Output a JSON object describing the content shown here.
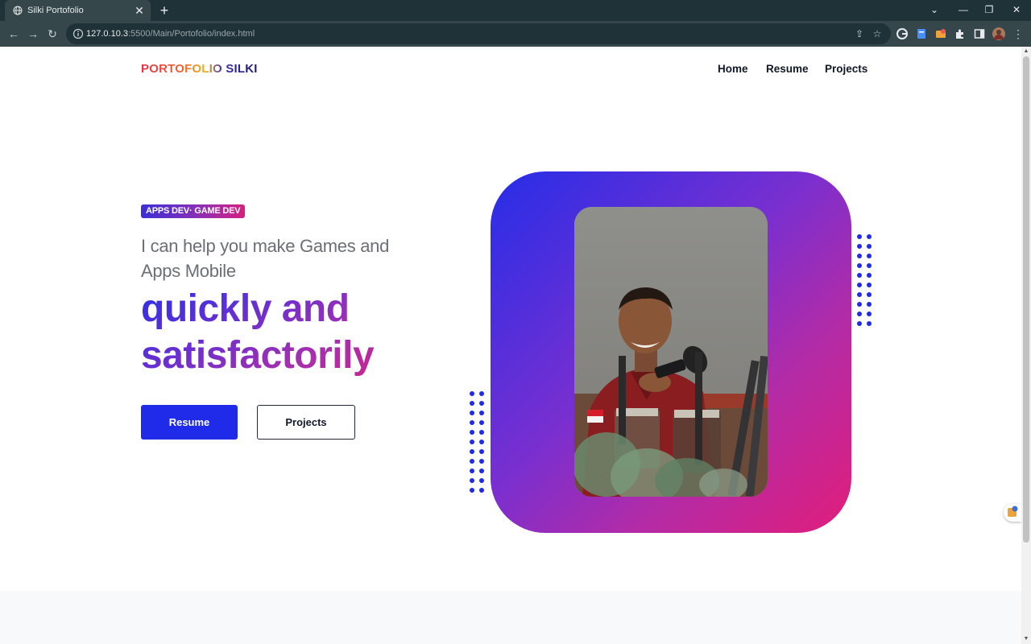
{
  "browser": {
    "tab_title": "Silki Portofolio",
    "url_host": "127.0.10.3",
    "url_rest": ":5500/Main/Portofolio/index.html",
    "icons": {
      "globe": "globe-icon",
      "close": "close-icon",
      "new_tab": "plus-icon",
      "back": "arrow-left-icon",
      "forward": "arrow-right-icon",
      "reload": "reload-icon",
      "info": "info-icon",
      "share": "share-icon",
      "bookmark": "star-icon",
      "extensions": "puzzle-icon",
      "sidepanel": "sidepanel-icon",
      "menu": "more-vertical-icon"
    },
    "colors": {
      "tabbar": "#1f3237",
      "toolbar": "#35474b"
    }
  },
  "site": {
    "logo": "PORTOFOLIO SILKI",
    "nav": [
      "Home",
      "Resume",
      "Projects"
    ]
  },
  "hero": {
    "badge": "APPS DEV· GAME DEV",
    "lead": "I can help you make Games and Apps Mobile",
    "headline": "quickly and satisfactorily",
    "primary_button": "Resume",
    "secondary_button": "Projects"
  },
  "colors": {
    "primary": "#1f2be8",
    "gradient_start": "#262ee8",
    "gradient_end": "#e21d7a",
    "dots": "#1f2be8"
  }
}
